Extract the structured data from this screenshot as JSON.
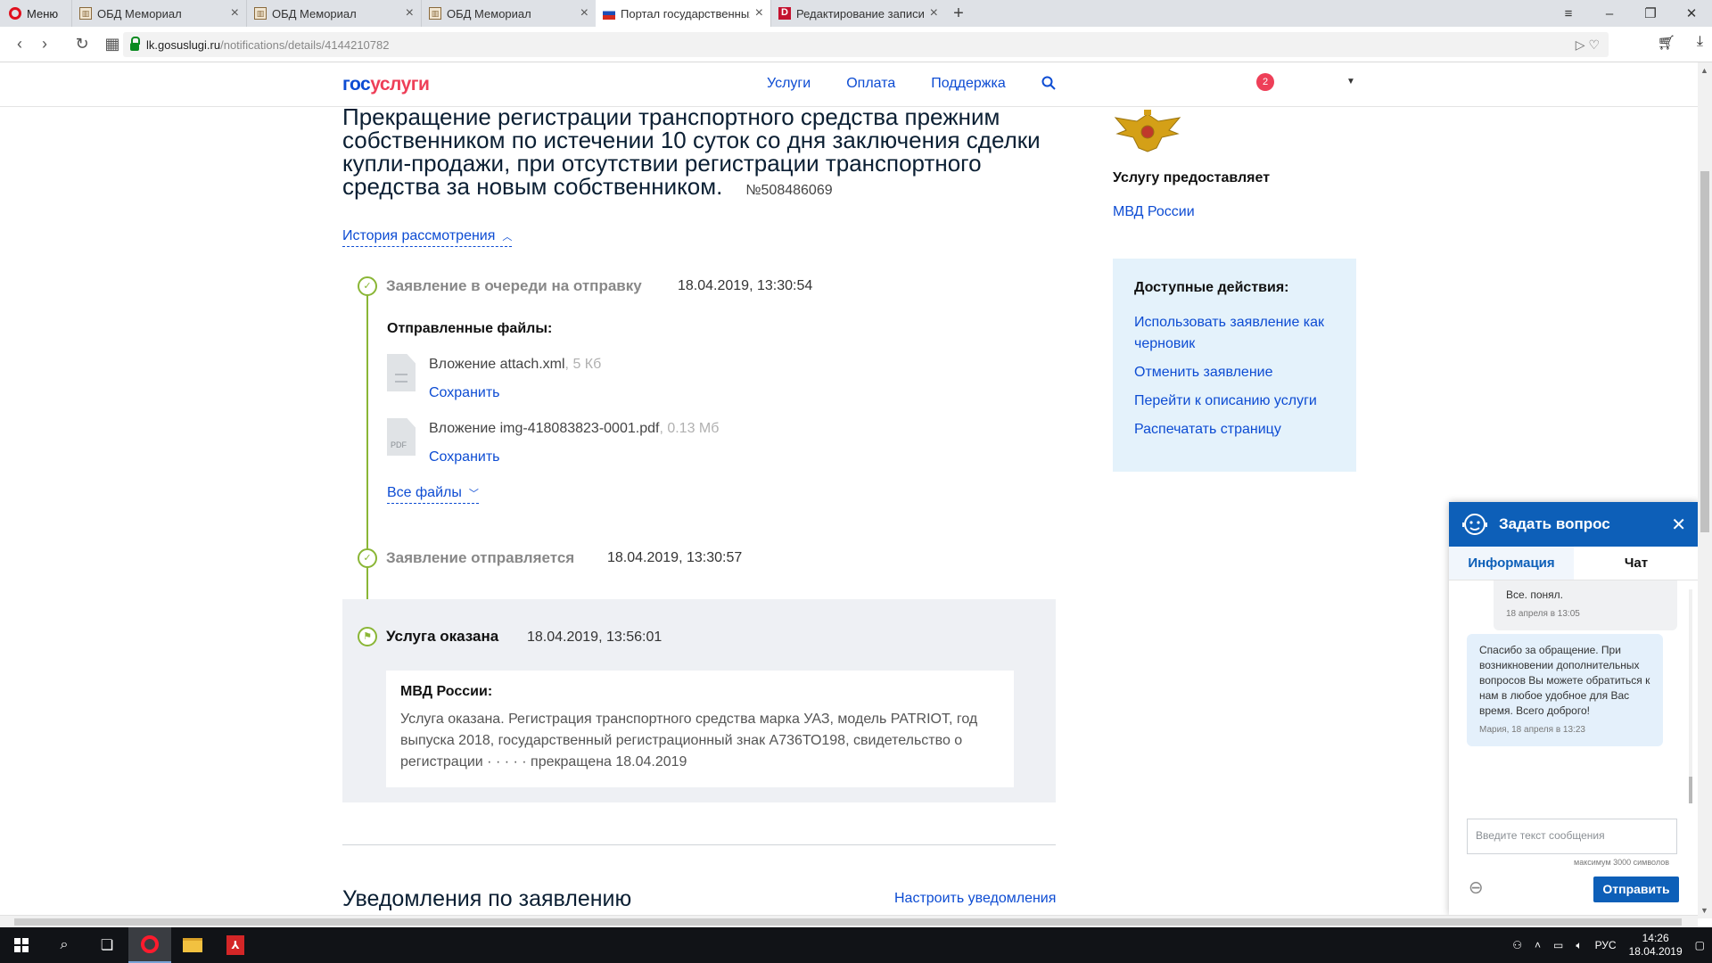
{
  "browser": {
    "menu_label": "Меню",
    "tabs": [
      {
        "label": "ОБД Мемориал",
        "icon": "memorial-favicon"
      },
      {
        "label": "ОБД Мемориал",
        "icon": "memorial-favicon"
      },
      {
        "label": "ОБД Мемориал",
        "icon": "memorial-favicon"
      },
      {
        "label": "Портал государственных",
        "icon": "russia-flag-favicon"
      },
      {
        "label": "Редактирование записи",
        "icon": "d-favicon"
      }
    ],
    "url_host": "lk.gosuslugi.ru",
    "url_path": "/notifications/details/4144210782"
  },
  "header": {
    "logo_part1": "гос",
    "logo_part2": "услуги",
    "nav": [
      "Услуги",
      "Оплата",
      "Поддержка"
    ],
    "notification_count": "2"
  },
  "main": {
    "title": "Прекращение регистрации транспортного средства прежним собственником по истечении 10 суток со дня заключения сделки купли-продажи, при отсутствии регистрации транспортного средства за новым собственником.",
    "request_number": "№508486069",
    "history_toggle": "История рассмотрения",
    "steps": [
      {
        "title": "Заявление в очереди на отправку",
        "date": "18.04.2019, 13:30:54"
      },
      {
        "title": "Заявление отправляется",
        "date": "18.04.2019, 13:30:57"
      },
      {
        "title": "Услуга оказана",
        "date": "18.04.2019, 13:56:01"
      }
    ],
    "files_heading": "Отправленные файлы:",
    "files": [
      {
        "name": "Вложение attach.xml",
        "size": ", 5 Кб",
        "action": "Сохранить"
      },
      {
        "name": "Вложение img-418083823-0001.pdf",
        "size": ", 0.13 Мб",
        "action": "Сохранить"
      }
    ],
    "pdf_icon_label": "PDF",
    "all_files": "Все файлы",
    "result": {
      "org": "МВД России:",
      "text": "Услуга оказана. Регистрация транспортного средства марка УАЗ, модель PATRIOT, год выпуска 2018, государственный регистрационный знак А736ТО198, свидетельство о регистрации  ·  ·  ·  ·  · прекращена 18.04.2019"
    },
    "notifications_heading": "Уведомления по заявлению",
    "notifications_settings": "Настроить уведомления"
  },
  "sidebar": {
    "provider_label": "Услугу предоставляет",
    "provider_name": "МВД России",
    "actions_title": "Доступные действия:",
    "actions": [
      "Использовать заявление как черновик",
      "Отменить заявление",
      "Перейти к описанию услуги",
      "Распечатать страницу"
    ]
  },
  "chat": {
    "title": "Задать вопрос",
    "tabs": [
      "Информация",
      "Чат"
    ],
    "messages": [
      {
        "text": "Все. понял.",
        "meta": "18 апреля в 13:05"
      },
      {
        "text": "Спасибо за обращение. При возникновении дополнительных вопросов Вы можете обратиться к нам в любое удобное для Вас время. Всего доброго!",
        "meta": "Мария, 18 апреля в 13:23"
      }
    ],
    "input_placeholder": "Введите текст сообщения",
    "limit_note": "максимум 3000 символов",
    "send_label": "Отправить"
  },
  "taskbar": {
    "language": "РУС",
    "time": "14:26",
    "date": "18.04.2019"
  },
  "colors": {
    "brand_blue": "#0d4cd3",
    "brand_red": "#ee3f58",
    "timeline_green": "#8ab636",
    "chat_blue": "#0d5fb8"
  }
}
